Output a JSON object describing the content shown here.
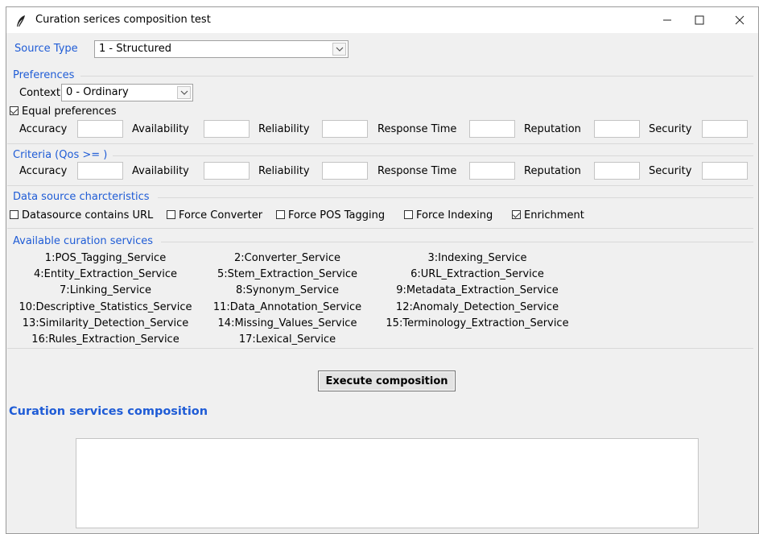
{
  "window": {
    "title": "Curation serices composition test",
    "icon": "feather-icon",
    "controls": [
      "minimize-icon",
      "maximize-icon",
      "close-icon"
    ]
  },
  "source": {
    "label": "Source Type",
    "selected": "1 - Structured"
  },
  "preferences": {
    "header": "Preferences",
    "context_label": "Context",
    "context_selected": "0 - Ordinary",
    "equal_label": "Equal preferences",
    "equal_checked": true,
    "fields": [
      "Accuracy",
      "Availability",
      "Reliability",
      "Response Time",
      "Reputation",
      "Security"
    ]
  },
  "criteria": {
    "header": "Criteria (Qos >= )",
    "fields": [
      "Accuracy",
      "Availability",
      "Reliability",
      "Response Time",
      "Reputation",
      "Security"
    ]
  },
  "datasource": {
    "header": "Data source charcteristics",
    "options": [
      {
        "label": "Datasource contains URL",
        "checked": false
      },
      {
        "label": "Force Converter",
        "checked": false
      },
      {
        "label": "Force POS Tagging",
        "checked": false
      },
      {
        "label": "Force Indexing",
        "checked": false
      },
      {
        "label": "Enrichment",
        "checked": true
      }
    ]
  },
  "services": {
    "header": "Available curation services",
    "items": [
      "1:POS_Tagging_Service",
      "2:Converter_Service",
      "3:Indexing_Service",
      "4:Entity_Extraction_Service",
      "5:Stem_Extraction_Service",
      "6:URL_Extraction_Service",
      "7:Linking_Service",
      "8:Synonym_Service",
      "9:Metadata_Extraction_Service",
      "10:Descriptive_Statistics_Service",
      "11:Data_Annotation_Service",
      "12:Anomaly_Detection_Service",
      "13:Similarity_Detection_Service",
      "14:Missing_Values_Service",
      "15:Terminology_Extraction_Service",
      "16:Rules_Extraction_Service",
      "17:Lexical_Service"
    ]
  },
  "execute_label": "Execute composition",
  "output": {
    "title": "Curation services composition",
    "content": ""
  },
  "colors": {
    "accent": "#1f5cd6",
    "background": "#f0f0f0"
  }
}
